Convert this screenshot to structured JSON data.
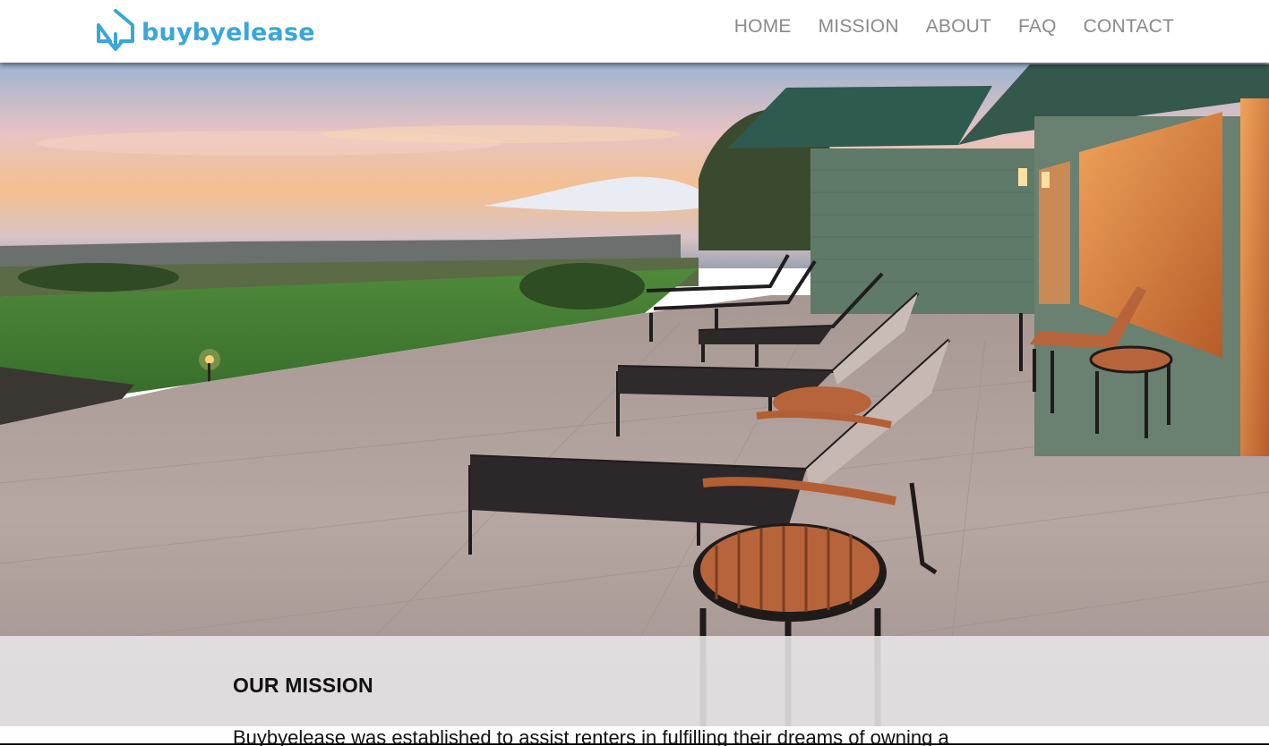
{
  "header": {
    "logo_text": "buybyelease",
    "brand_color": "#3aa6d9",
    "nav": [
      {
        "label": "HOME"
      },
      {
        "label": "MISSION"
      },
      {
        "label": "ABOUT"
      },
      {
        "label": "FAQ"
      },
      {
        "label": "CONTACT"
      }
    ]
  },
  "hero": {
    "image_subject": "patio-with-lounge-chairs-at-sunset"
  },
  "mission": {
    "title": "OUR MISSION",
    "text": "Buybyelease was established to assist renters in fulfilling their dreams of owning a"
  }
}
